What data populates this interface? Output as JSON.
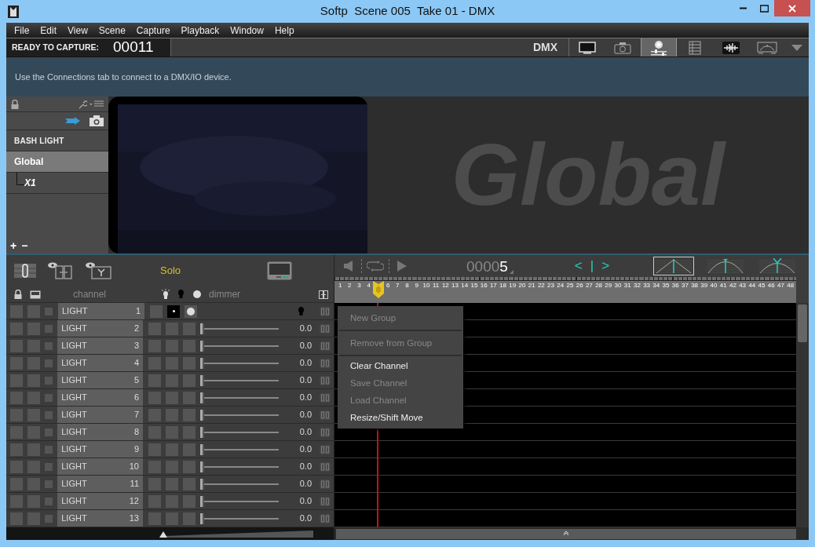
{
  "window": {
    "title": "Softp  Scene 005  Take 01 - DMX"
  },
  "menu": [
    "File",
    "Edit",
    "View",
    "Scene",
    "Capture",
    "Playback",
    "Window",
    "Help"
  ],
  "toolbar": {
    "status_label": "READY TO CAPTURE:",
    "frame": "00011",
    "mode": "DMX",
    "views": [
      {
        "kind": "monitor",
        "selected": false
      },
      {
        "kind": "camera",
        "selected": false
      },
      {
        "kind": "light",
        "selected": true
      },
      {
        "kind": "sheet",
        "selected": false
      },
      {
        "kind": "audio",
        "selected": false
      },
      {
        "kind": "gauge",
        "selected": false
      }
    ]
  },
  "notice": "Use the Connections tab to connect to a DMX/IO device.",
  "device_panel": {
    "title": "BASH LIGHT",
    "tree": [
      {
        "label": "Global",
        "selected": true,
        "children": [
          {
            "label": "X1",
            "selected": false
          }
        ]
      }
    ],
    "add": "+",
    "remove": "−"
  },
  "stage": {
    "group_label": "Global"
  },
  "channels": {
    "solo_label": "Solo",
    "headers": {
      "channel": "channel",
      "dimmer": "dimmer"
    },
    "rows": [
      {
        "kind": "master",
        "name": "LIGHT",
        "number": "1"
      },
      {
        "kind": "fader",
        "name": "LIGHT",
        "number": "2",
        "level": 0,
        "reading": "0.0"
      },
      {
        "kind": "fader",
        "name": "LIGHT",
        "number": "3",
        "level": 0,
        "reading": "0.0"
      },
      {
        "kind": "fader",
        "name": "LIGHT",
        "number": "4",
        "level": 0,
        "reading": "0.0"
      },
      {
        "kind": "fader",
        "name": "LIGHT",
        "number": "5",
        "level": 0,
        "reading": "0.0"
      },
      {
        "kind": "fader",
        "name": "LIGHT",
        "number": "6",
        "level": 0,
        "reading": "0.0"
      },
      {
        "kind": "fader",
        "name": "LIGHT",
        "number": "7",
        "level": 0,
        "reading": "0.0"
      },
      {
        "kind": "fader",
        "name": "LIGHT",
        "number": "8",
        "level": 0,
        "reading": "0.0"
      },
      {
        "kind": "fader",
        "name": "LIGHT",
        "number": "9",
        "level": 0,
        "reading": "0.0"
      },
      {
        "kind": "fader",
        "name": "LIGHT",
        "number": "10",
        "level": 0,
        "reading": "0.0"
      },
      {
        "kind": "fader",
        "name": "LIGHT",
        "number": "11",
        "level": 0,
        "reading": "0.0"
      },
      {
        "kind": "fader",
        "name": "LIGHT",
        "number": "12",
        "level": 0,
        "reading": "0.0"
      },
      {
        "kind": "fader",
        "name": "LIGHT",
        "number": "13",
        "level": 0,
        "reading": "0.0"
      }
    ]
  },
  "transport": {
    "counter": "0000",
    "counter_current": "5",
    "prev": "<",
    "marker": "|",
    "next": ">",
    "curves": [
      {
        "kind": "linear",
        "selected": true
      },
      {
        "kind": "ease",
        "selected": false
      },
      {
        "kind": "peak",
        "selected": false
      }
    ]
  },
  "timeline": {
    "ruler": [
      {
        "kind": "tick",
        "label": "1"
      },
      {
        "kind": "tick",
        "label": "2"
      },
      {
        "kind": "tick",
        "label": "3"
      },
      {
        "kind": "tick",
        "label": "4"
      },
      {
        "kind": "playhead"
      },
      {
        "kind": "tick",
        "label": "6"
      },
      {
        "kind": "tick",
        "label": "7"
      },
      {
        "kind": "tick",
        "label": "8"
      },
      {
        "kind": "tick",
        "label": "9"
      },
      {
        "kind": "tick",
        "label": "10"
      },
      {
        "kind": "tick",
        "label": "11"
      },
      {
        "kind": "tick",
        "label": "12"
      },
      {
        "kind": "tick",
        "label": "13"
      },
      {
        "kind": "tick",
        "label": "14"
      },
      {
        "kind": "tick",
        "label": "15"
      },
      {
        "kind": "tick",
        "label": "16"
      },
      {
        "kind": "tick",
        "label": "17"
      },
      {
        "kind": "tick",
        "label": "18"
      },
      {
        "kind": "tick",
        "label": "19"
      },
      {
        "kind": "tick",
        "label": "20"
      },
      {
        "kind": "tick",
        "label": "21"
      },
      {
        "kind": "tick",
        "label": "22"
      },
      {
        "kind": "tick",
        "label": "23"
      },
      {
        "kind": "tick",
        "label": "24"
      },
      {
        "kind": "tick",
        "label": "25"
      },
      {
        "kind": "tick",
        "label": "26"
      },
      {
        "kind": "tick",
        "label": "27"
      },
      {
        "kind": "tick",
        "label": "28"
      },
      {
        "kind": "tick",
        "label": "29"
      },
      {
        "kind": "tick",
        "label": "30"
      },
      {
        "kind": "tick",
        "label": "31"
      },
      {
        "kind": "tick",
        "label": "32"
      },
      {
        "kind": "tick",
        "label": "33"
      },
      {
        "kind": "tick",
        "label": "34"
      },
      {
        "kind": "tick",
        "label": "35"
      },
      {
        "kind": "tick",
        "label": "36"
      },
      {
        "kind": "tick",
        "label": "37"
      },
      {
        "kind": "tick",
        "label": "38"
      },
      {
        "kind": "tick",
        "label": "39"
      },
      {
        "kind": "tick",
        "label": "40"
      },
      {
        "kind": "tick",
        "label": "41"
      },
      {
        "kind": "tick",
        "label": "42"
      },
      {
        "kind": "tick",
        "label": "43"
      },
      {
        "kind": "tick",
        "label": "44"
      },
      {
        "kind": "tick",
        "label": "45"
      },
      {
        "kind": "tick",
        "label": "46"
      },
      {
        "kind": "tick",
        "label": "47"
      },
      {
        "kind": "tick",
        "label": "48"
      }
    ]
  },
  "zoom": {
    "level": 0
  },
  "context_menu": [
    {
      "label": "New Group",
      "disabled": true,
      "divider_after": true
    },
    {
      "label": "Remove from Group",
      "disabled": true,
      "divider_after": true
    },
    {
      "label": "Clear Channel",
      "disabled": false,
      "divider_after": false
    },
    {
      "label": "Save Channel",
      "disabled": true,
      "divider_after": false
    },
    {
      "label": "Load Channel",
      "disabled": true,
      "divider_after": false
    },
    {
      "label": "Resize/Shift Move",
      "disabled": false,
      "divider_after": false
    }
  ]
}
